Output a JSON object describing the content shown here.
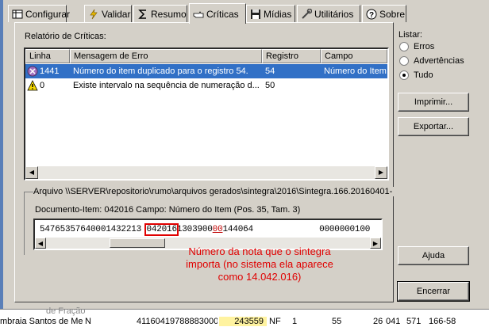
{
  "tabs": [
    {
      "label": "Configurar",
      "icon": "table-icon"
    },
    {
      "label": "Validar",
      "icon": "lightning-icon"
    },
    {
      "label": "Resumo",
      "icon": "sum-icon"
    },
    {
      "label": "Críticas",
      "icon": "pointing-hand-icon",
      "active": true
    },
    {
      "label": "Mídias",
      "icon": "disk-icon"
    },
    {
      "label": "Utilitários",
      "icon": "tools-icon"
    },
    {
      "label": "Sobre",
      "icon": "help-icon"
    }
  ],
  "report": {
    "title": "Relatório de Críticas:",
    "columns": [
      "Linha",
      "Mensagem de Erro",
      "Registro",
      "Campo"
    ],
    "rows": [
      {
        "icon": "error-icon",
        "linha": "1441",
        "mensagem": "Número do item duplicado para o registro 54.",
        "registro": "54",
        "campo": "Número do Item",
        "selected": true
      },
      {
        "icon": "warning-icon",
        "linha": "0",
        "mensagem": "Existe intervalo na sequência de numeração d...",
        "registro": "50",
        "campo": "",
        "selected": false
      }
    ]
  },
  "detail": {
    "arquivo": "Arquivo \\\\SERVER\\repositorio\\rumo\\arquivos gerados\\sintegra\\2016\\Sintegra.166.20160401-",
    "documento_item": "Documento-Item: 042016  Campo: Número do Item (Pos. 35, Tam. 3)",
    "raw_line": {
      "before": "54765357640001432213 ",
      "highlight": "042016",
      "middle": "1303900",
      "underline": "00",
      "after": "144064             0000000100"
    }
  },
  "annotation": "Número da nota que o sintegra importa (no sistema ela aparece como 14.042.016)",
  "listar": {
    "label": "Listar:",
    "options": [
      {
        "label": "Erros",
        "selected": false
      },
      {
        "label": "Advertências",
        "selected": false
      },
      {
        "label": "Tudo",
        "selected": true
      }
    ]
  },
  "buttons": {
    "imprimir": "Imprimir...",
    "exportar": "Exportar...",
    "ajuda": "Ajuda",
    "encerrar": "Encerrar"
  },
  "background_row": {
    "top_text": "de Fração",
    "cells": [
      "mbraia Santos de Melo",
      "N",
      "41160419788883000",
      "243559",
      "NF",
      "1",
      "55",
      "26",
      "041",
      "571",
      "166-58"
    ]
  }
}
